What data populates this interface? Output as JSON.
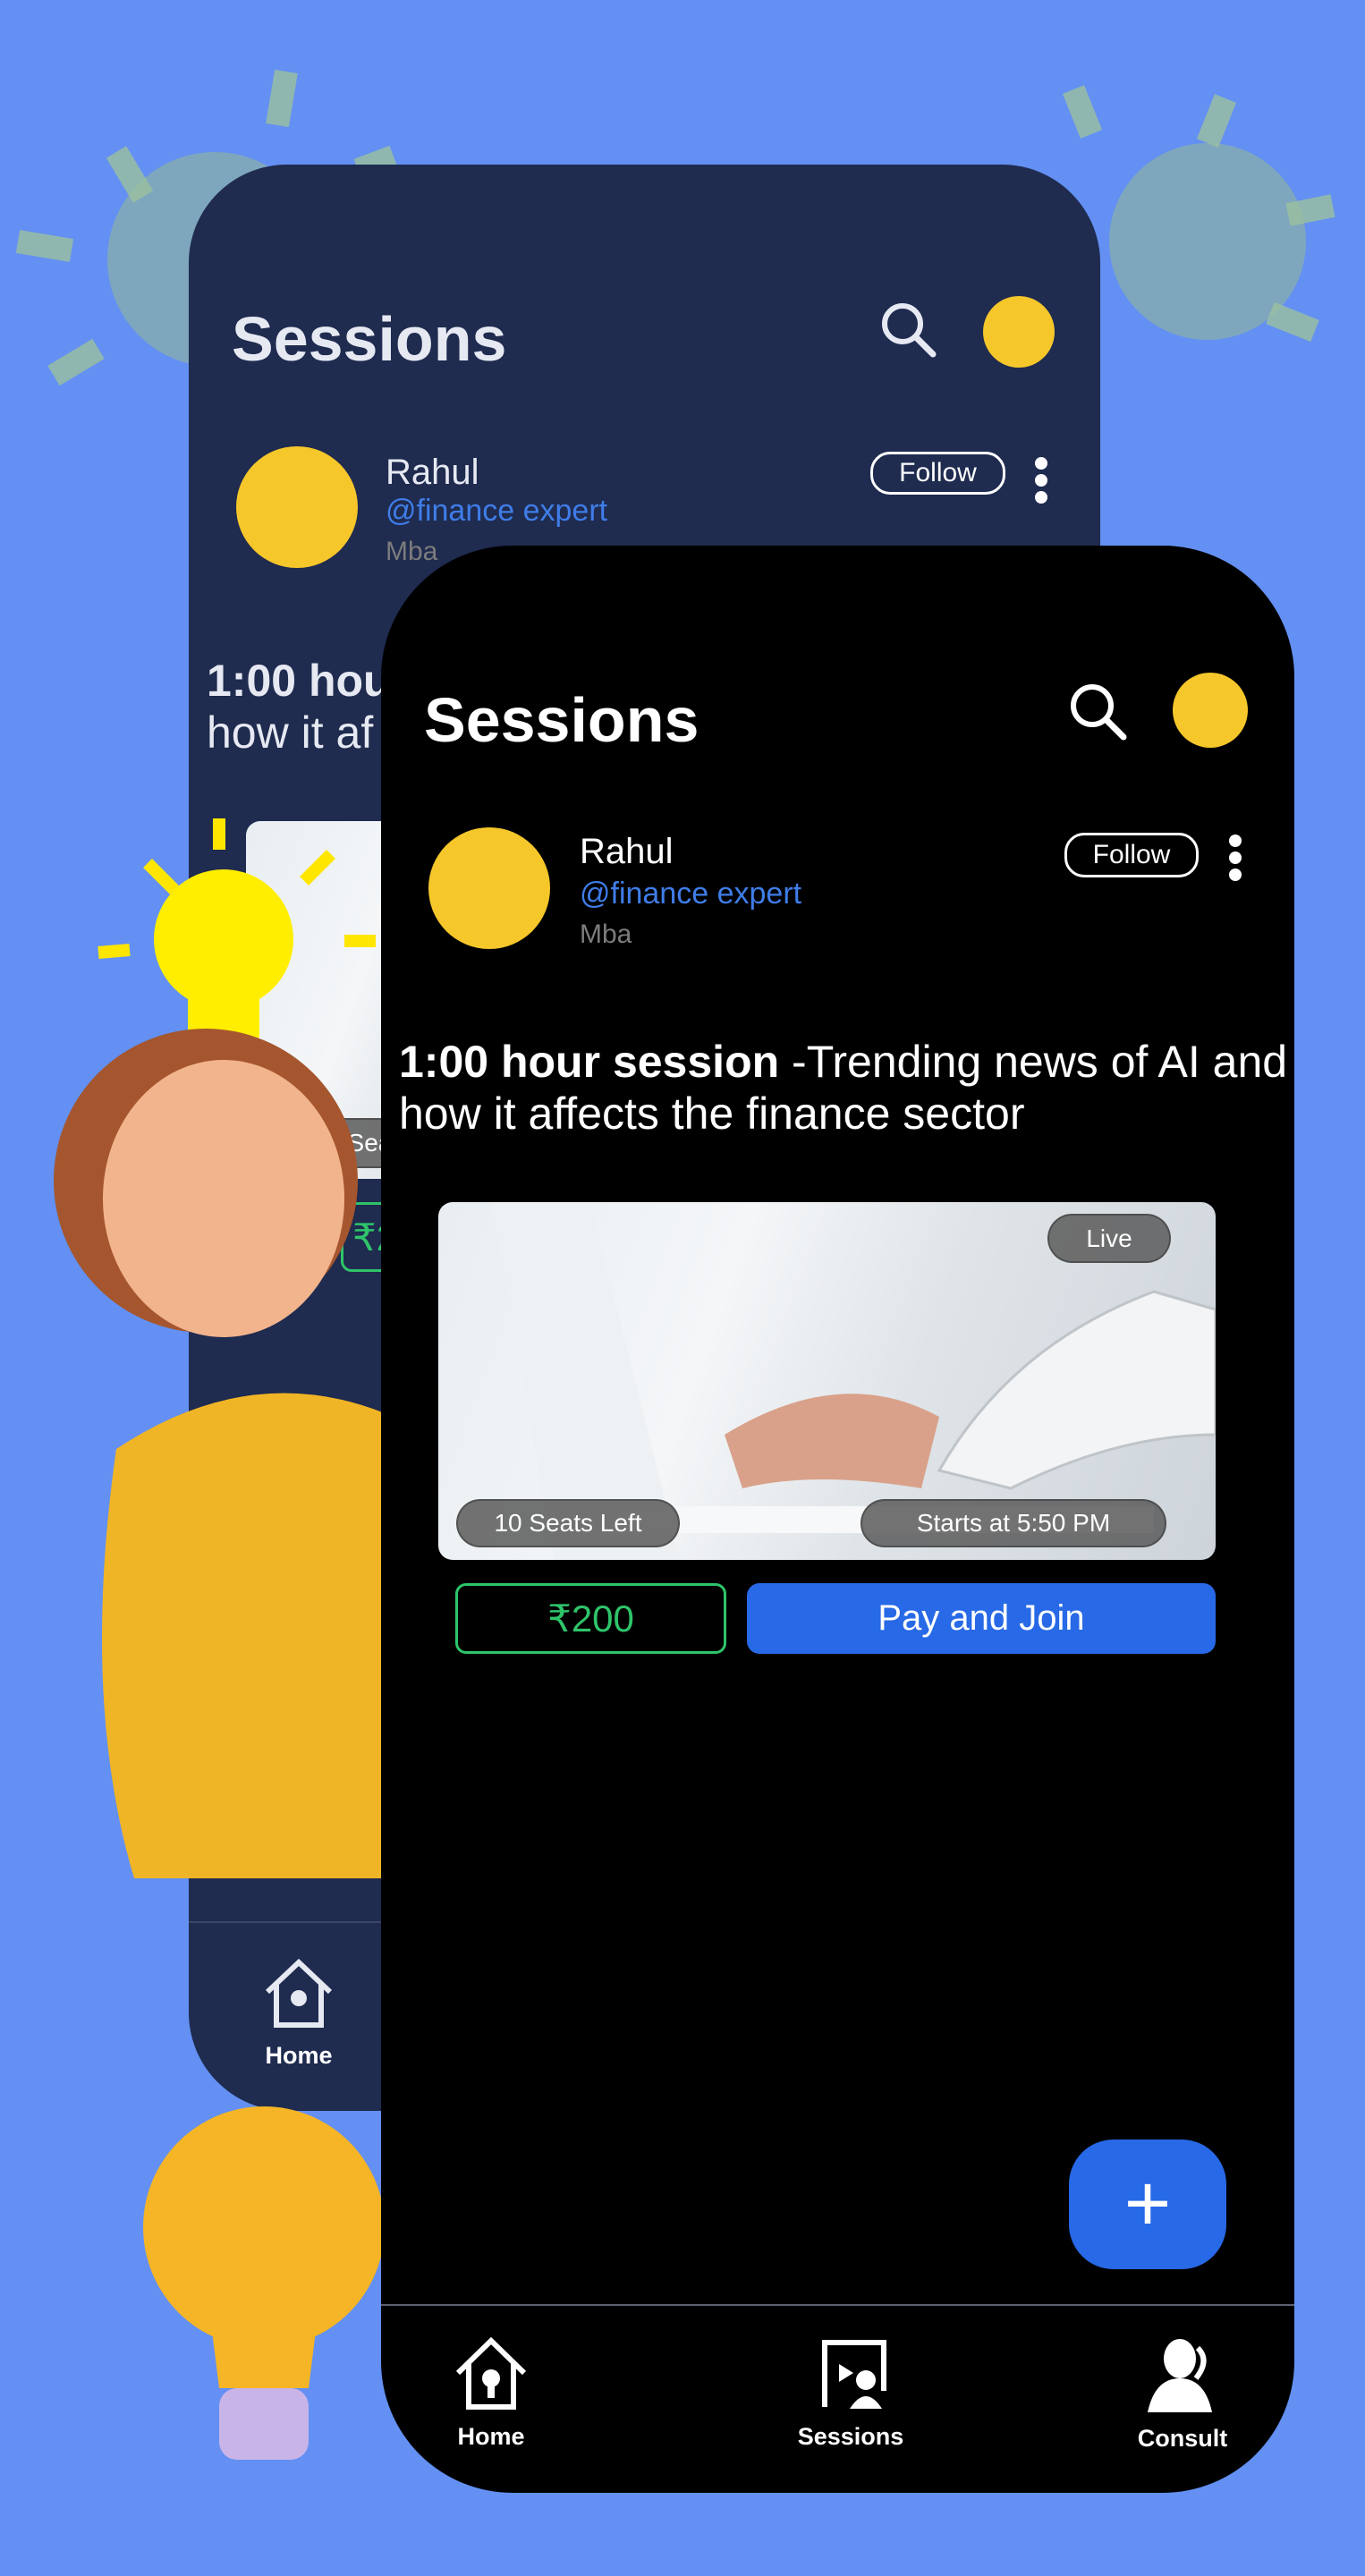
{
  "colors": {
    "background": "#6390f2",
    "back_phone": "#1f2b4f",
    "front_phone": "#000000",
    "accent": "#2769e6",
    "price": "#2fc46a",
    "handle": "#3f7de8"
  },
  "back_screen": {
    "header": {
      "title": "Sessions",
      "search_icon": "search-icon"
    },
    "profile": {
      "name": "Rahul",
      "handle": "@finance expert",
      "subtitle": "Mba",
      "follow_label": "Follow"
    },
    "session": {
      "title_bold": "1:00 hou",
      "title_rest": "how it af",
      "seats": "10 Sea",
      "price": "₹2"
    },
    "nav": {
      "home": "Home"
    }
  },
  "front_screen": {
    "header": {
      "title": "Sessions",
      "search_icon": "search-icon"
    },
    "profile": {
      "name": "Rahul",
      "handle": "@finance expert",
      "subtitle": "Mba",
      "follow_label": "Follow"
    },
    "session": {
      "title_bold": "1:00 hour session",
      "title_rest": " -Trending news of AI and how it affects the finance sector",
      "live_badge": "Live",
      "seats": "10 Seats Left",
      "starts": "Starts at 5:50 PM",
      "price": "₹200",
      "pay_label": "Pay and Join"
    },
    "fab_label": "+",
    "nav": [
      {
        "label": "Home",
        "icon": "home-bulb-icon"
      },
      {
        "label": "Sessions",
        "icon": "video-person-icon"
      },
      {
        "label": "Consult",
        "icon": "consultant-phone-icon"
      }
    ]
  }
}
